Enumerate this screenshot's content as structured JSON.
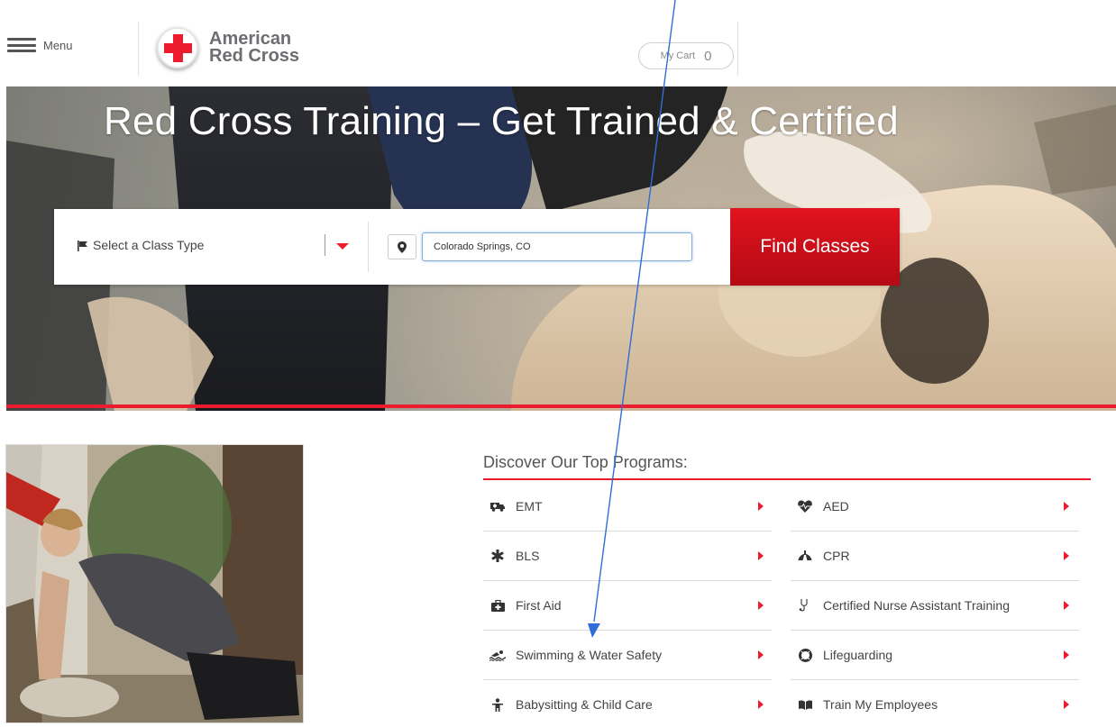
{
  "header": {
    "menu_label": "Menu",
    "logo_line1": "American",
    "logo_line2": "Red Cross",
    "cart_label": "My Cart",
    "cart_count": "0"
  },
  "hero": {
    "title": "Red Cross Training – Get Trained & Certified",
    "class_select_label": "Select a Class Type",
    "location_value": "Colorado Springs, CO",
    "find_button": "Find Classes"
  },
  "programs": {
    "heading": "Discover Our Top Programs:",
    "left": [
      {
        "label": "EMT",
        "icon": "ambulance-icon"
      },
      {
        "label": "BLS",
        "icon": "star-of-life-icon"
      },
      {
        "label": "First Aid",
        "icon": "first-aid-kit-icon"
      },
      {
        "label": "Swimming & Water Safety",
        "icon": "swimmer-icon"
      },
      {
        "label": "Babysitting & Child Care",
        "icon": "child-icon"
      }
    ],
    "right": [
      {
        "label": "AED",
        "icon": "heartbeat-icon"
      },
      {
        "label": "CPR",
        "icon": "cpr-lungs-icon"
      },
      {
        "label": "Certified Nurse Assistant Training",
        "icon": "stethoscope-icon"
      },
      {
        "label": "Lifeguarding",
        "icon": "life-ring-icon"
      },
      {
        "label": "Train My Employees",
        "icon": "book-icon"
      }
    ]
  },
  "colors": {
    "brand_red": "#ed1b2e",
    "annotation_blue": "#2f6ed6"
  }
}
